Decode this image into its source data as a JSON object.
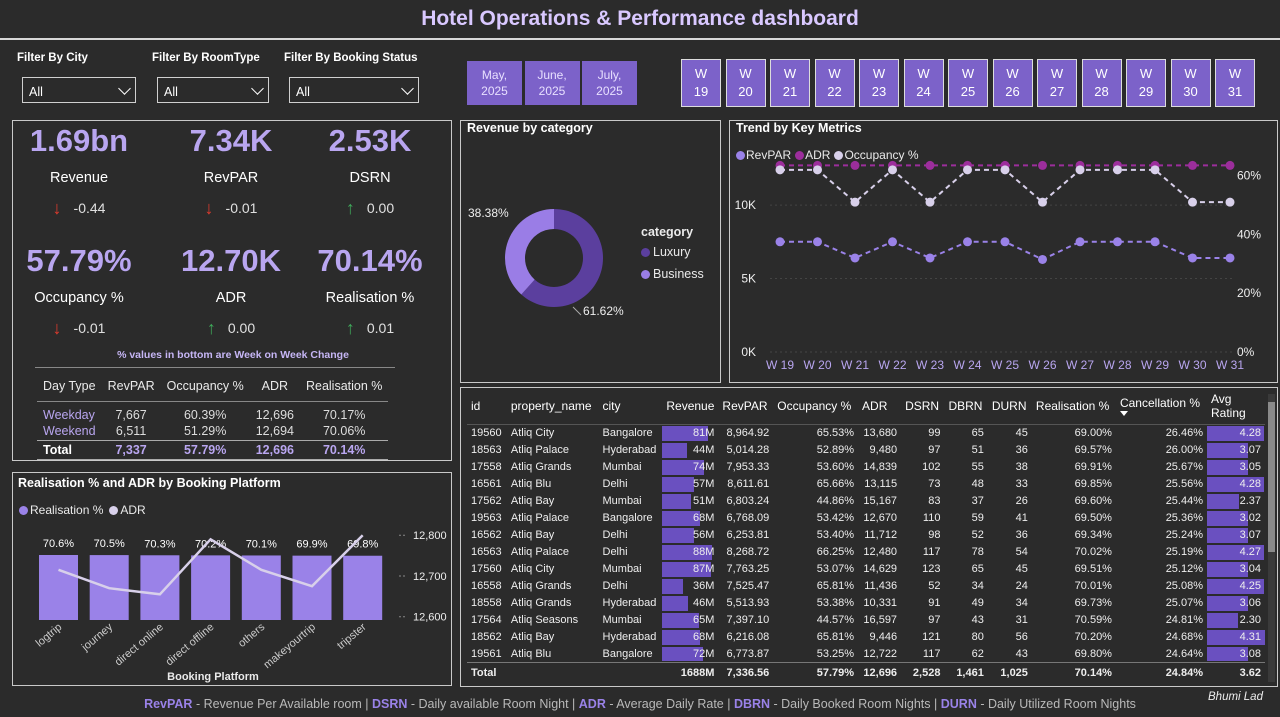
{
  "title": "Hotel Operations & Performance dashboard",
  "filters": [
    {
      "label": "Filter By City",
      "value": "All"
    },
    {
      "label": "Filter By RoomType",
      "value": "All"
    },
    {
      "label": "Filter By Booking Status",
      "value": "All"
    }
  ],
  "months": [
    {
      "line1": "May,",
      "line2": "2025"
    },
    {
      "line1": "June,",
      "line2": "2025"
    },
    {
      "line1": "July,",
      "line2": "2025"
    }
  ],
  "weeks": [
    {
      "w": "W",
      "n": "19"
    },
    {
      "w": "W",
      "n": "20"
    },
    {
      "w": "W",
      "n": "21"
    },
    {
      "w": "W",
      "n": "22"
    },
    {
      "w": "W",
      "n": "23"
    },
    {
      "w": "W",
      "n": "24"
    },
    {
      "w": "W",
      "n": "25"
    },
    {
      "w": "W",
      "n": "26"
    },
    {
      "w": "W",
      "n": "27"
    },
    {
      "w": "W",
      "n": "28"
    },
    {
      "w": "W",
      "n": "29"
    },
    {
      "w": "W",
      "n": "30"
    },
    {
      "w": "W",
      "n": "31"
    }
  ],
  "kpis": [
    {
      "value": "1.69bn",
      "label": "Revenue",
      "change": "-0.44",
      "dir": "down"
    },
    {
      "value": "7.34K",
      "label": "RevPAR",
      "change": "-0.01",
      "dir": "down"
    },
    {
      "value": "2.53K",
      "label": "DSRN",
      "change": "0.00",
      "dir": "up"
    },
    {
      "value": "57.79%",
      "label": "Occupancy %",
      "change": "-0.01",
      "dir": "down"
    },
    {
      "value": "12.70K",
      "label": "ADR",
      "change": "0.00",
      "dir": "up"
    },
    {
      "value": "70.14%",
      "label": "Realisation %",
      "change": "0.01",
      "dir": "up"
    }
  ],
  "kpi_note": "% values in bottom are Week on Week Change",
  "daytype_table": {
    "headers": [
      "Day Type",
      "RevPAR",
      "Occupancy %",
      "ADR",
      "Realisation %"
    ],
    "rows": [
      [
        "Weekday",
        "7,667",
        "60.39%",
        "12,696",
        "70.17%"
      ],
      [
        "Weekend",
        "6,511",
        "51.29%",
        "12,694",
        "70.06%"
      ]
    ],
    "total": [
      "Total",
      "7,337",
      "57.79%",
      "12,696",
      "70.14%"
    ]
  },
  "donut": {
    "title": "Revenue by category",
    "legend_title": "category",
    "slices": [
      {
        "name": "Luxury",
        "pct": 61.62,
        "label": "61.62%",
        "color": "#5b3f9e"
      },
      {
        "name": "Business",
        "pct": 38.38,
        "label": "38.38%",
        "color": "#9a7de6"
      }
    ]
  },
  "trend": {
    "title": "Trend by Key Metrics",
    "legend": [
      {
        "name": "RevPAR",
        "color": "#9a82e8"
      },
      {
        "name": "ADR",
        "color": "#9c2e9c"
      },
      {
        "name": "Occupancy %",
        "color": "#d8d0ea"
      }
    ],
    "left_ticks": [
      "10K",
      "5K",
      "0K"
    ],
    "right_ticks": [
      "60%",
      "40%",
      "20%",
      "0%"
    ],
    "x_labels": [
      "W 19",
      "W 20",
      "W 21",
      "W 22",
      "W 23",
      "W 24",
      "W 25",
      "W 26",
      "W 27",
      "W 28",
      "W 29",
      "W 30",
      "W 31"
    ]
  },
  "chart_data": [
    {
      "type": "line",
      "title": "Trend by Key Metrics",
      "x": [
        "W 19",
        "W 20",
        "W 21",
        "W 22",
        "W 23",
        "W 24",
        "W 25",
        "W 26",
        "W 27",
        "W 28",
        "W 29",
        "W 30",
        "W 31"
      ],
      "series": [
        {
          "name": "RevPAR",
          "axis": "left",
          "values": [
            7500,
            7500,
            6400,
            7500,
            6400,
            7500,
            7500,
            6300,
            7500,
            7500,
            7500,
            6400,
            6400
          ]
        },
        {
          "name": "ADR",
          "axis": "left",
          "values": [
            12700,
            12700,
            12700,
            12700,
            12700,
            12700,
            12700,
            12700,
            12700,
            12700,
            12700,
            12700,
            12700
          ]
        },
        {
          "name": "Occupancy %",
          "axis": "right",
          "values": [
            62,
            62,
            51,
            62,
            51,
            62,
            62,
            51,
            62,
            62,
            62,
            51,
            51
          ]
        }
      ],
      "ylim_left": [
        0,
        13000
      ],
      "ylim_right": [
        0,
        65
      ]
    },
    {
      "type": "bar",
      "title": "Realisation % and ADR by Booking Platform",
      "xlabel": "Booking Platform",
      "categories": [
        "logtrip",
        "journey",
        "direct online",
        "direct offline",
        "others",
        "makeyourtrip",
        "tripster"
      ],
      "series": [
        {
          "name": "Realisation %",
          "axis": "left",
          "values": [
            70.6,
            70.5,
            70.3,
            70.2,
            70.1,
            69.9,
            69.8
          ],
          "labels": [
            "70.6%",
            "70.5%",
            "70.3%",
            "70.2%",
            "70.1%",
            "69.9%",
            "69.8%"
          ]
        },
        {
          "name": "ADR",
          "axis": "right",
          "values": [
            12715,
            12670,
            12655,
            12790,
            12715,
            12675,
            12800
          ]
        }
      ],
      "right_ticks": [
        "12,800",
        "12,700",
        "12,600"
      ],
      "ylim_right": [
        12560,
        12830
      ]
    },
    {
      "type": "pie",
      "title": "Revenue by category",
      "labels": [
        "Luxury",
        "Business"
      ],
      "values": [
        61.62,
        38.38
      ]
    }
  ],
  "platform_chart": {
    "title": "Realisation % and ADR by Booking Platform",
    "legend": [
      {
        "name": "Realisation %",
        "color": "#9a82e8"
      },
      {
        "name": "ADR",
        "color": "#d8d0ea"
      }
    ],
    "xlabel": "Booking Platform"
  },
  "property_table": {
    "headers": [
      "id",
      "property_name",
      "city",
      "Revenue",
      "RevPAR",
      "Occupancy %",
      "ADR",
      "DSRN",
      "DBRN",
      "DURN",
      "Realisation %",
      "Cancellation %",
      "Avg Rating"
    ],
    "rows": [
      [
        "19560",
        "Atliq City",
        "Bangalore",
        "81M",
        "8,964.92",
        "65.53%",
        "13,680",
        "99",
        "65",
        "45",
        "69.00%",
        "26.46%",
        "4.28"
      ],
      [
        "18563",
        "Atliq Palace",
        "Hyderabad",
        "44M",
        "5,014.28",
        "52.89%",
        "9,480",
        "97",
        "51",
        "36",
        "69.57%",
        "26.00%",
        "3.07"
      ],
      [
        "17558",
        "Atliq Grands",
        "Mumbai",
        "74M",
        "7,953.33",
        "53.60%",
        "14,839",
        "102",
        "55",
        "38",
        "69.91%",
        "25.67%",
        "3.05"
      ],
      [
        "16561",
        "Atliq Blu",
        "Delhi",
        "57M",
        "8,611.61",
        "65.66%",
        "13,115",
        "73",
        "48",
        "33",
        "69.85%",
        "25.56%",
        "4.28"
      ],
      [
        "17562",
        "Atliq Bay",
        "Mumbai",
        "51M",
        "6,803.24",
        "44.86%",
        "15,167",
        "83",
        "37",
        "26",
        "69.60%",
        "25.44%",
        "2.37"
      ],
      [
        "19563",
        "Atliq Palace",
        "Bangalore",
        "68M",
        "6,768.09",
        "53.42%",
        "12,670",
        "110",
        "59",
        "41",
        "69.50%",
        "25.36%",
        "3.02"
      ],
      [
        "16562",
        "Atliq Bay",
        "Delhi",
        "56M",
        "6,253.81",
        "53.40%",
        "11,712",
        "98",
        "52",
        "36",
        "69.34%",
        "25.24%",
        "3.07"
      ],
      [
        "16563",
        "Atliq Palace",
        "Delhi",
        "88M",
        "8,268.72",
        "66.25%",
        "12,480",
        "117",
        "78",
        "54",
        "70.02%",
        "25.19%",
        "4.27"
      ],
      [
        "17560",
        "Atliq City",
        "Mumbai",
        "87M",
        "7,763.25",
        "53.07%",
        "14,629",
        "123",
        "65",
        "45",
        "69.51%",
        "25.12%",
        "3.04"
      ],
      [
        "16558",
        "Atliq Grands",
        "Delhi",
        "36M",
        "7,525.47",
        "65.81%",
        "11,436",
        "52",
        "34",
        "24",
        "70.01%",
        "25.08%",
        "4.25"
      ],
      [
        "18558",
        "Atliq Grands",
        "Hyderabad",
        "46M",
        "5,513.93",
        "53.38%",
        "10,331",
        "91",
        "49",
        "34",
        "69.73%",
        "25.07%",
        "3.06"
      ],
      [
        "17564",
        "Atliq Seasons",
        "Mumbai",
        "65M",
        "7,397.10",
        "44.57%",
        "16,597",
        "97",
        "43",
        "31",
        "70.59%",
        "24.81%",
        "2.30"
      ],
      [
        "18562",
        "Atliq Bay",
        "Hyderabad",
        "68M",
        "6,216.08",
        "65.81%",
        "9,446",
        "121",
        "80",
        "56",
        "70.20%",
        "24.68%",
        "4.31"
      ],
      [
        "19561",
        "Atliq Blu",
        "Bangalore",
        "72M",
        "6,773.87",
        "53.25%",
        "12,722",
        "117",
        "62",
        "43",
        "69.80%",
        "24.64%",
        "3.08"
      ]
    ],
    "revenue_fraction": [
      0.81,
      0.44,
      0.74,
      0.57,
      0.51,
      0.68,
      0.56,
      0.88,
      0.87,
      0.36,
      0.46,
      0.65,
      0.68,
      0.72
    ],
    "rating_fraction": [
      0.99,
      0.71,
      0.71,
      0.99,
      0.55,
      0.7,
      0.71,
      0.99,
      0.7,
      0.98,
      0.71,
      0.53,
      1.0,
      0.71
    ],
    "total": [
      "Total",
      "",
      "",
      "1688M",
      "7,336.56",
      "57.79%",
      "12,696",
      "2,528",
      "1,461",
      "1,025",
      "70.14%",
      "24.84%",
      "3.62"
    ]
  },
  "footer": [
    {
      "key": "RevPAR",
      "desc": " - Revenue Per Available room | "
    },
    {
      "key": "DSRN",
      "desc": " - Daily available Room Night | "
    },
    {
      "key": "ADR",
      "desc": " - Average Daily Rate | "
    },
    {
      "key": "DBRN",
      "desc": " - Daily Booked Room Nights | "
    },
    {
      "key": "DURN",
      "desc": " - Daily Utilized Room Nights"
    }
  ],
  "author": "Bhumi Lad"
}
